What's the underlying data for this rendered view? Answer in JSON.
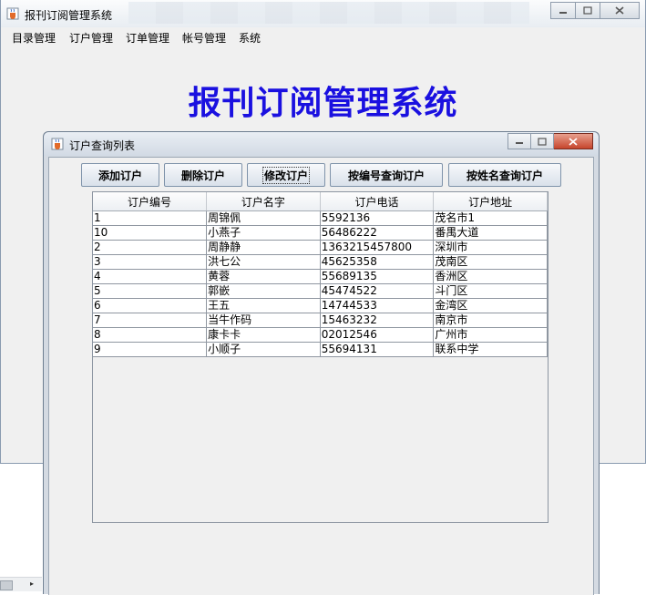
{
  "main_window": {
    "title": "报刊订阅管理系统",
    "menu": [
      "目录管理",
      "订户管理",
      "订单管理",
      "帐号管理",
      "系统"
    ],
    "hero_title": "报刊订阅管理系统"
  },
  "child_window": {
    "title": "订户查询列表",
    "buttons": {
      "add": "添加订户",
      "delete": "删除订户",
      "edit": "修改订户",
      "query_id": "按编号查询订户",
      "query_name": "按姓名查询订户"
    },
    "table": {
      "headers": [
        "订户编号",
        "订户名字",
        "订户电话",
        "订户地址"
      ],
      "rows": [
        [
          "1",
          "周锦佩",
          "5592136",
          "茂名市1"
        ],
        [
          "10",
          "小燕子",
          "56486222",
          "番禺大道"
        ],
        [
          "2",
          "周静静",
          "1363215457800",
          "深圳市"
        ],
        [
          "3",
          "洪七公",
          "45625358",
          "茂南区"
        ],
        [
          "4",
          "黄蓉",
          "55689135",
          "香洲区"
        ],
        [
          "5",
          "郭嵌",
          "45474522",
          "斗门区"
        ],
        [
          "6",
          "王五",
          "14744533",
          "金湾区"
        ],
        [
          "7",
          "当牛作码",
          "15463232",
          "南京市"
        ],
        [
          "8",
          "康卡卡",
          "02012546",
          "广州市"
        ],
        [
          "9",
          "小顺子",
          "55694131",
          "联系中学"
        ]
      ]
    }
  },
  "icons": {
    "app_icon": "java-cup-icon",
    "minimize": "minimize-icon",
    "maximize": "maximize-icon",
    "close": "close-icon"
  },
  "colors": {
    "hero_title": "#1a10e0",
    "close_button": "#c6452c"
  }
}
